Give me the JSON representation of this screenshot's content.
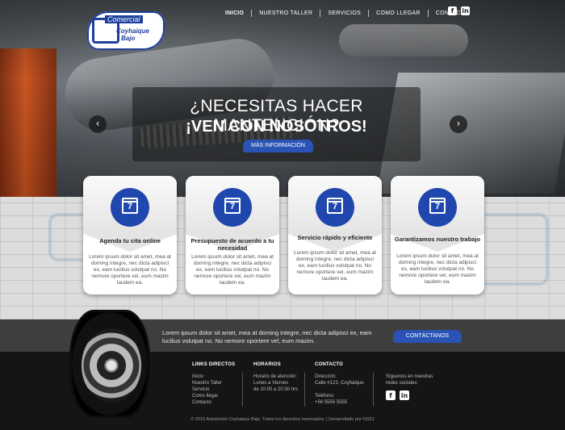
{
  "logo": {
    "line1": "Comercial",
    "line2": "Coyhaique",
    "line3": "Bajo"
  },
  "nav": {
    "items": [
      {
        "label": "INICIO"
      },
      {
        "label": "NUESTRO TALLER"
      },
      {
        "label": "SERVICIOS"
      },
      {
        "label": "COMO LLEGAR"
      },
      {
        "label": "CONTACTO"
      }
    ]
  },
  "social": {
    "facebook": "f",
    "linkedin": "in"
  },
  "hero": {
    "line1": "¿NECESITAS HACER MANTENCIÓN?",
    "line2": "¡VEN CON NOSOTROS!",
    "button": "MÁS INFORMACIÓN",
    "prev": "‹",
    "next": "›"
  },
  "cards": [
    {
      "icon_num": "7",
      "title": "Agenda tu cita online",
      "text": "Lorem ipsum dolor sit amet, mea at doming integre, nec dicta adipisci ex, eam lucilius volutpat no. No nemore oportere vel, eum mazim laudem ea."
    },
    {
      "icon_num": "7",
      "title": "Presupuesto de acuerdo a tu necesidad",
      "text": "Lorem ipsum dolor sit amet, mea at doming integre, nec dicta adipisci ex, eam lucilius volutpat no. No nemore oportere vel, eum mazim laudem ea."
    },
    {
      "icon_num": "7",
      "title": "Servicio rápido y eficiente",
      "text": "Lorem ipsum dolor sit amet, mea at doming integre, nec dicta adipisci ex, eam lucilius volutpat no. No nemore oportere vel, eum mazim laudem ea."
    },
    {
      "icon_num": "7",
      "title": "Garantizamos nuestro trabajo",
      "text": "Lorem ipsum dolor sit amet, mea at doming integre, nec dicta adipisci ex, eam lucilius volutpat no. No nemore oportere vel, eum mazim laudem ea."
    }
  ],
  "band": {
    "text": "Lorem ipsum dolor sit amet, mea at doming integre, nec dicta adipisci ex, eam lucilius volutpat no. No nemore oportere vel, eum mazim.",
    "button": "CONTÁCTANOS"
  },
  "footer": {
    "links_heading": "LINKS DIRECTOS",
    "links": [
      "Inicio",
      "Nuestro Taller",
      "Servicio",
      "Como llegar",
      "Contacto"
    ],
    "hours_heading": "HORARIOS",
    "hours": [
      "Horario de atención:",
      "Lunes a Viernes",
      "de 10:00 a 20:30 hrs"
    ],
    "contact_heading": "CONTACTO",
    "address_label": "Dirección:",
    "address": "Calle #123, Coyhaique",
    "phone_label": "Teléfono:",
    "phone": "+56 5555 5555",
    "social_text": "Síguenos en nuestras redes sociales:",
    "copyright": "© 2015 Automotriz Coyhaique Bajo. Todos los derechos reservados. | Desarrollado por OD21"
  },
  "colors": {
    "accent_blue": "#1f47ad",
    "button_blue": "#2a53b5",
    "footer_bg": "#151515"
  }
}
